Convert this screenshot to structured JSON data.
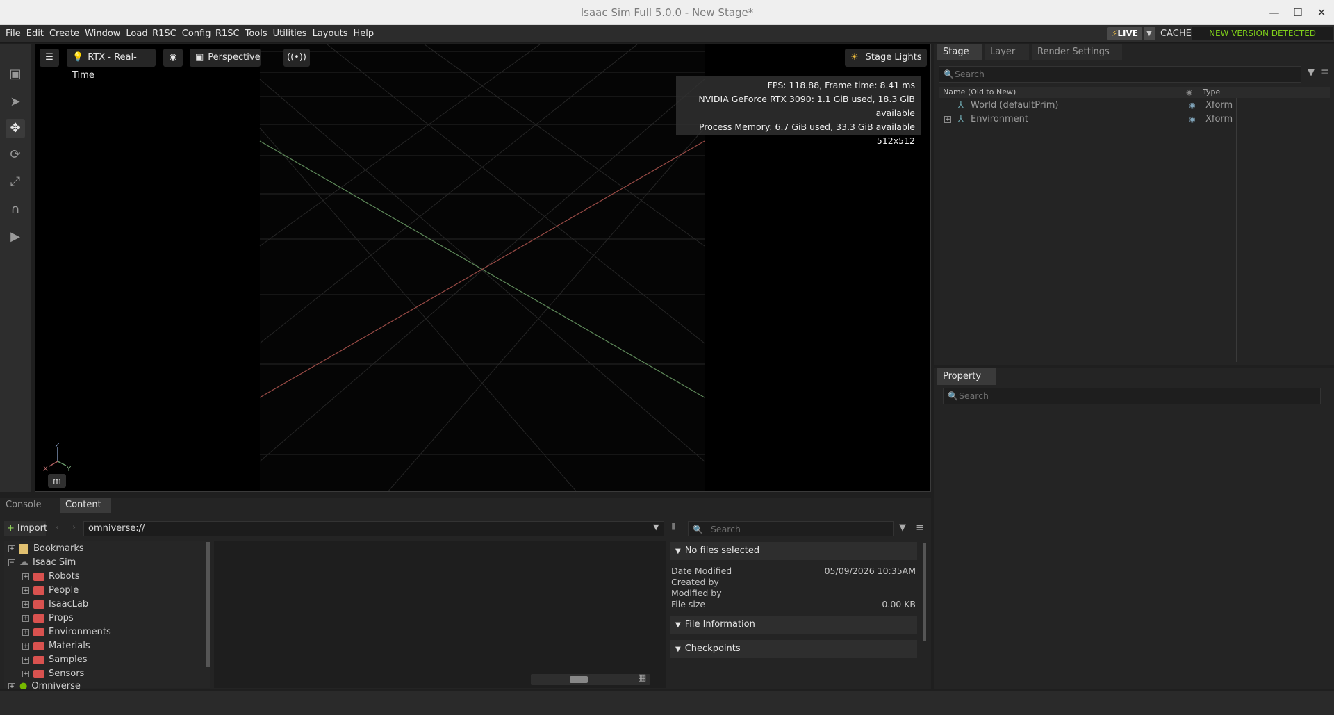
{
  "window": {
    "title": "Isaac Sim Full 5.0.0 - New Stage*",
    "controls": [
      "—",
      "☐",
      "✕"
    ]
  },
  "menu": {
    "items": [
      "File",
      "Edit",
      "Create",
      "Window",
      "Load_R1SC",
      "Config_R1SC",
      "Tools",
      "Utilities",
      "Layouts",
      "Help"
    ],
    "live_label": "LIVE",
    "cache_label": "CACHE:",
    "cache_status": "NEW VERSION DETECTED",
    "cache_status_color": "#7fcf1a"
  },
  "toolbar": {
    "tools": [
      "select-icon",
      "pointer-icon",
      "move-icon",
      "rotate-icon",
      "scale-icon",
      "snap-icon",
      "play-icon"
    ]
  },
  "viewport": {
    "renderer": "RTX - Real-Time",
    "camera": "Perspective",
    "lights": "Stage Lights",
    "stats": [
      "FPS: 118.88, Frame time: 8.41 ms",
      "NVIDIA GeForce RTX 3090: 1.1 GiB used, 18.3 GiB available",
      "Process Memory: 6.7 GiB used, 33.3 GiB available",
      "512x512"
    ],
    "axis_labels": {
      "z": "Z",
      "x": "X",
      "y": "Y"
    },
    "unit": "m"
  },
  "stage": {
    "tabs": [
      "Stage",
      "Layer",
      "Render Settings"
    ],
    "search_placeholder": "Search",
    "col_name": "Name (Old to New)",
    "col_type": "Type",
    "rows": [
      {
        "name": "World (defaultPrim)",
        "type": "Xform"
      },
      {
        "name": "Environment",
        "type": "Xform"
      }
    ]
  },
  "property": {
    "tab": "Property",
    "search_placeholder": "Search"
  },
  "bottom": {
    "tabs": [
      "Console",
      "Content"
    ],
    "import_label": "Import",
    "path": "omniverse://",
    "search_placeholder": "Search",
    "tree": {
      "bookmarks": "Bookmarks",
      "root": "Isaac Sim",
      "folders": [
        "Robots",
        "People",
        "IsaacLab",
        "Props",
        "Environments",
        "Materials",
        "Samples",
        "Sensors"
      ],
      "omniverse": "Omniverse"
    },
    "details": {
      "no_files": "No files selected",
      "date_modified_label": "Date Modified",
      "date_modified": "05/09/2026 10:35AM",
      "created_by_label": "Created by",
      "modified_by_label": "Modified by",
      "file_size_label": "File size",
      "file_size": "0.00 KB",
      "file_info": "File Information",
      "checkpoints": "Checkpoints"
    }
  }
}
